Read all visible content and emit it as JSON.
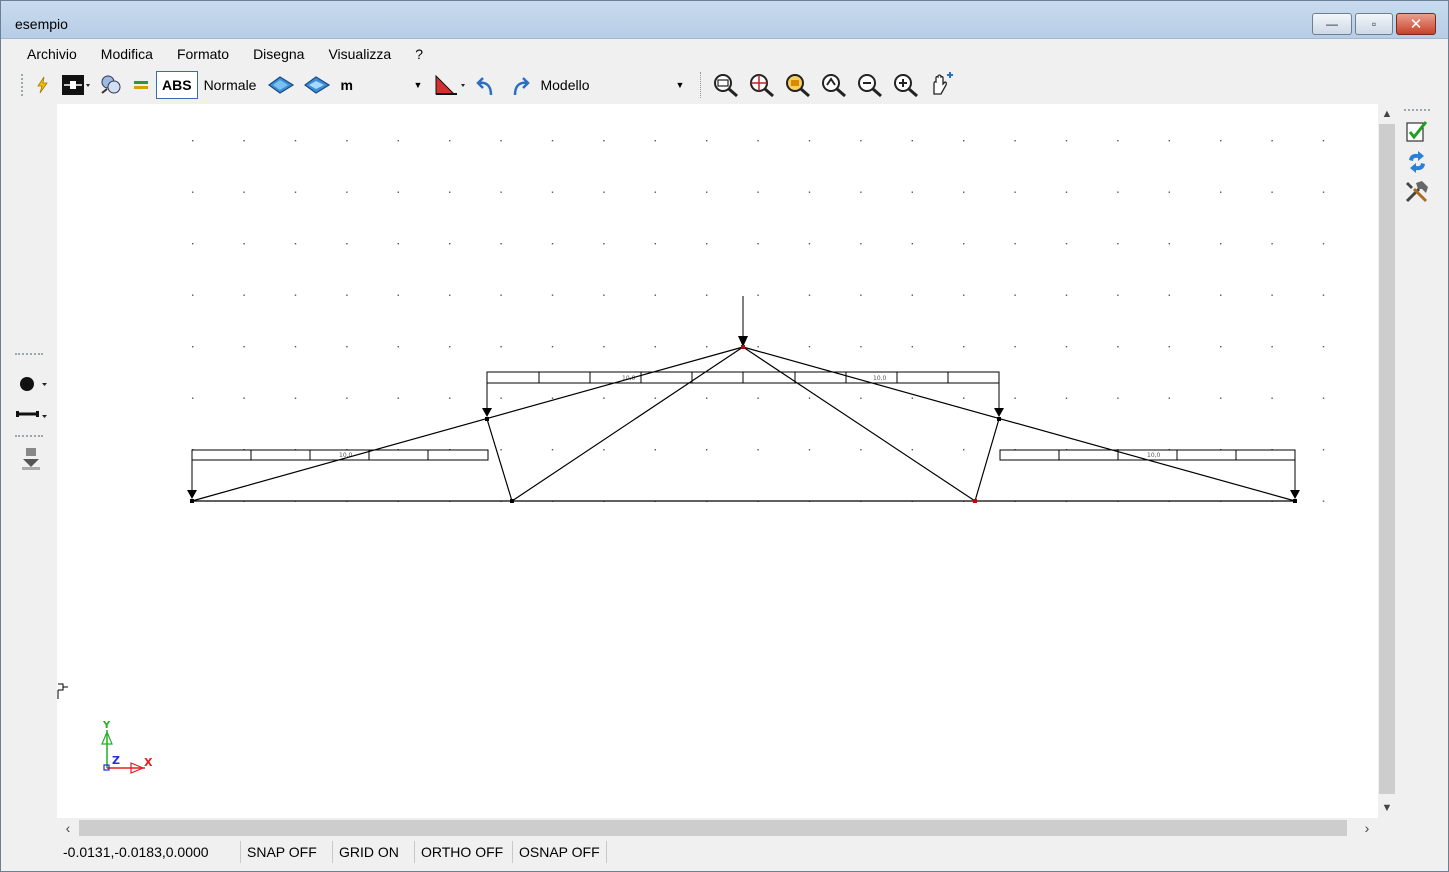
{
  "window": {
    "title": "esempio",
    "controls": {
      "minimize": "—",
      "maximize": "▫",
      "close": "✕"
    }
  },
  "menu": [
    "Archivio",
    "Modifica",
    "Formato",
    "Disegna",
    "Visualizza",
    "?"
  ],
  "toolbar": {
    "abs_label": "ABS",
    "mode_label": "Normale",
    "unit_value": "m",
    "view_value": "Modello"
  },
  "structure": {
    "load_labels": [
      "10,0",
      "10,0",
      "10,0",
      "10,0"
    ]
  },
  "axes": {
    "y": "Y",
    "z": "Z",
    "x": "X"
  },
  "status": {
    "coords": "-0.0131,-0.0183,0.0000",
    "snap": "SNAP OFF",
    "grid": "GRID ON",
    "ortho": "ORTHO OFF",
    "osnap": "OSNAP OFF"
  },
  "colors": {
    "accent": "#3a6ab0",
    "node_highlight": "#cc0000",
    "axis_x": "#e02020",
    "axis_y": "#20b020",
    "axis_z": "#2030d0"
  }
}
